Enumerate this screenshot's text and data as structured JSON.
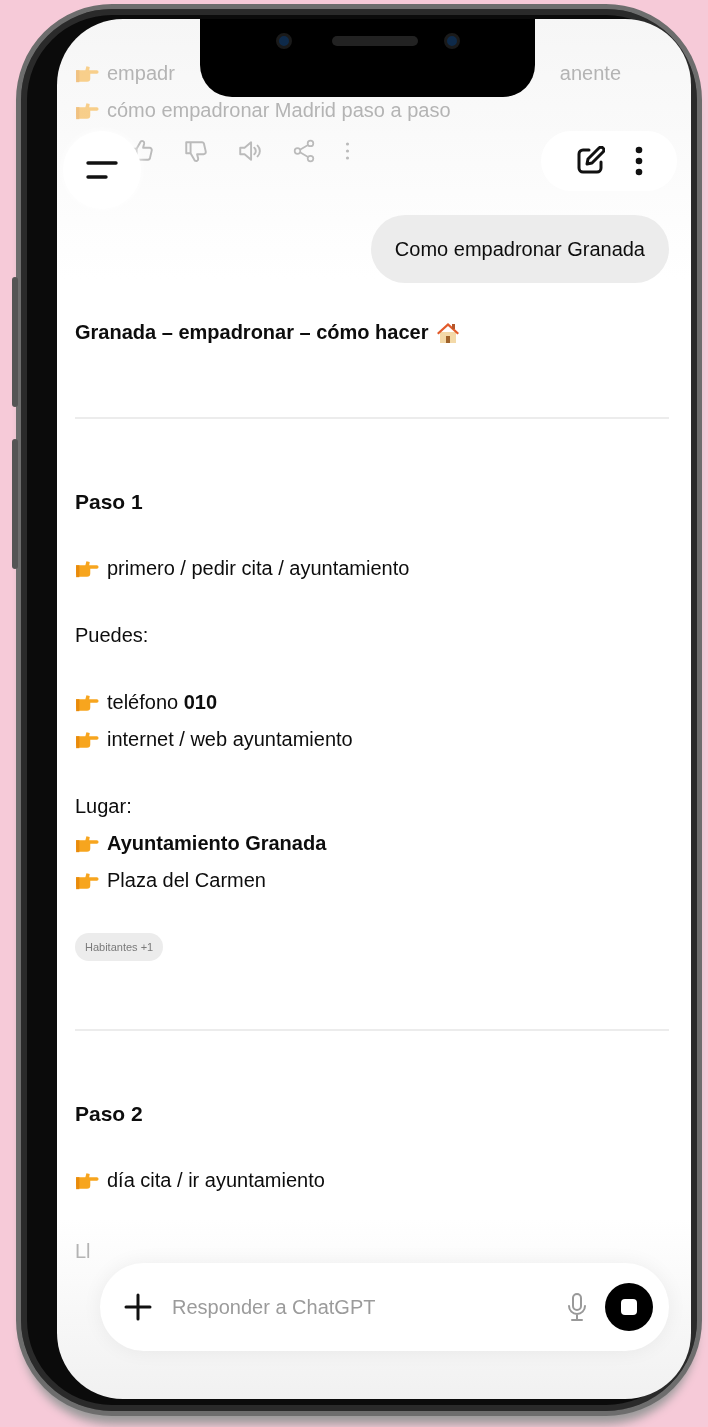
{
  "previous_message": {
    "lines": [
      {
        "parts": [
          "empadr",
          "anente"
        ]
      },
      {
        "parts": [
          "cómo empadronar Madrid paso a paso"
        ]
      }
    ]
  },
  "user_message": "Como empadronar Granada",
  "response": {
    "title": "Granada – empadronar – cómo hacer",
    "blocks": [
      {
        "kind": "divider"
      },
      {
        "kind": "heading",
        "text": "Paso 1"
      },
      {
        "kind": "list",
        "items": [
          {
            "text": "primero / pedir cita / ayuntamiento",
            "bold": false
          }
        ]
      },
      {
        "kind": "paragraph",
        "text": "Puedes:"
      },
      {
        "kind": "list",
        "items": [
          {
            "text": "teléfono **010**",
            "bold": false
          },
          {
            "text": "internet / web ayuntamiento",
            "bold": false
          }
        ]
      },
      {
        "kind": "list",
        "label": "Lugar:",
        "items": [
          {
            "text": "Ayuntamiento Granada",
            "bold": true
          },
          {
            "text": "Plaza del Carmen",
            "bold": false
          }
        ]
      },
      {
        "kind": "chip",
        "text": "Habitantes +1"
      },
      {
        "kind": "divider"
      },
      {
        "kind": "heading",
        "text": "Paso 2"
      },
      {
        "kind": "list",
        "items": [
          {
            "text": "día cita / ir ayuntamiento",
            "bold": false
          }
        ]
      },
      {
        "kind": "faded",
        "text": "Ll"
      }
    ]
  },
  "composer": {
    "placeholder": "Responder a ChatGPT"
  }
}
